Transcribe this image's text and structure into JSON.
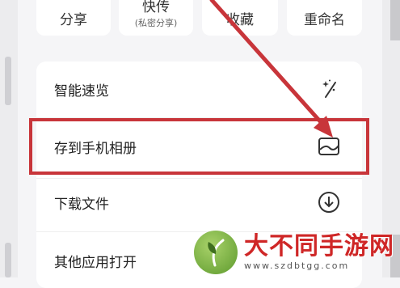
{
  "share_bar": {
    "share": "分享",
    "quick_send": "快传",
    "quick_send_sub": "(私密分享)",
    "favorite": "收藏",
    "rename": "重命名"
  },
  "menu": {
    "items": [
      {
        "label": "智能速览",
        "icon": "sparkle-wand-icon"
      },
      {
        "label": "存到手机相册",
        "icon": "photo-album-icon"
      },
      {
        "label": "下载文件",
        "icon": "download-circle-icon"
      },
      {
        "label": "其他应用打开",
        "icon": "open-with-icon"
      }
    ]
  },
  "annotation": {
    "color": "#c8353a"
  },
  "watermark": {
    "title": "大不同手游网",
    "url": "www.szdbtgg.com"
  }
}
